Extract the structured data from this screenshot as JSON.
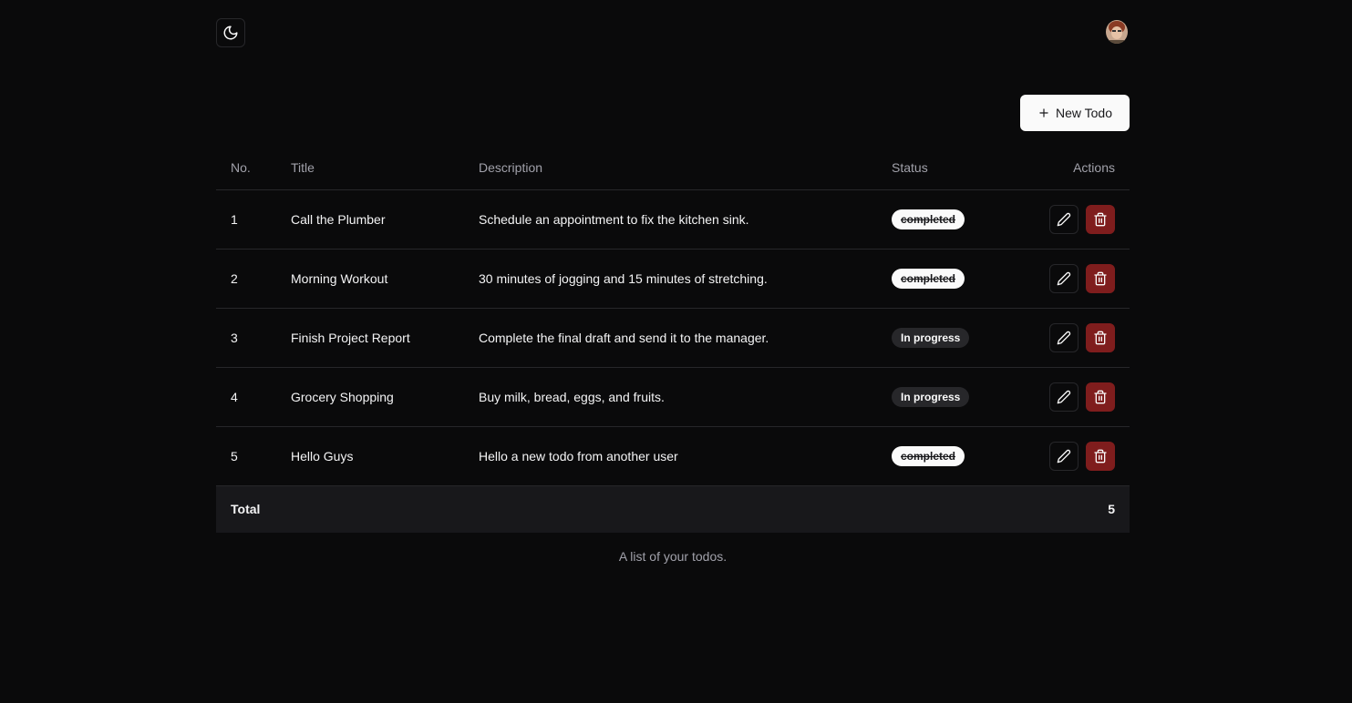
{
  "header": {
    "theme_icon": "moon-icon",
    "avatar_icon": "user-avatar"
  },
  "toolbar": {
    "new_todo_label": "New Todo"
  },
  "table": {
    "headers": {
      "no": "No.",
      "title": "Title",
      "description": "Description",
      "status": "Status",
      "actions": "Actions"
    },
    "rows": [
      {
        "no": "1",
        "title": "Call the Plumber",
        "description": "Schedule an appointment to fix the kitchen sink.",
        "status": "completed"
      },
      {
        "no": "2",
        "title": "Morning Workout",
        "description": "30 minutes of jogging and 15 minutes of stretching.",
        "status": "completed"
      },
      {
        "no": "3",
        "title": "Finish Project Report",
        "description": "Complete the final draft and send it to the manager.",
        "status": "In progress"
      },
      {
        "no": "4",
        "title": "Grocery Shopping",
        "description": "Buy milk, bread, eggs, and fruits.",
        "status": "In progress"
      },
      {
        "no": "5",
        "title": "Hello Guys",
        "description": "Hello a new todo from another user",
        "status": "completed"
      }
    ],
    "footer": {
      "label": "Total",
      "value": "5"
    },
    "caption": "A list of your todos."
  },
  "colors": {
    "background": "#0a0a0b",
    "delete": "#7f1d1d",
    "border": "#27272a"
  }
}
